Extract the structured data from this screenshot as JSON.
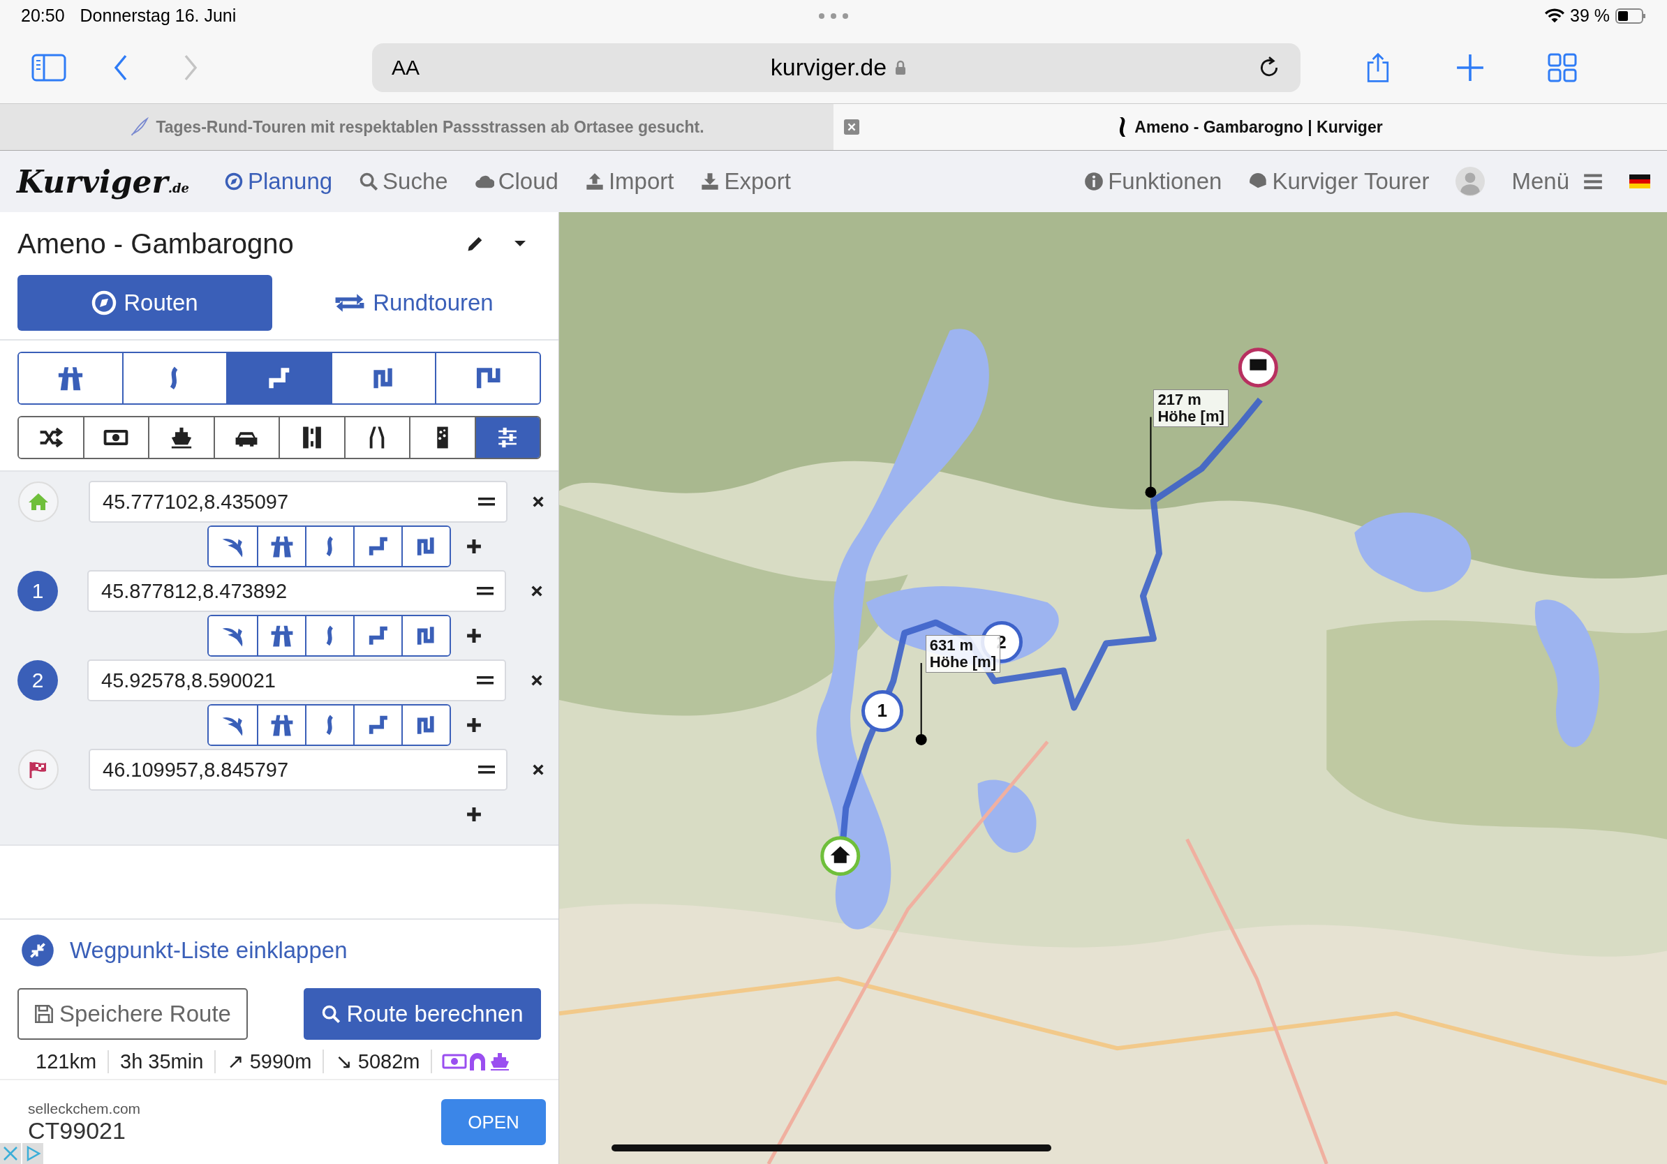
{
  "status_bar": {
    "time": "20:50",
    "date": "Donnerstag 16. Juni",
    "battery": "39 %"
  },
  "browser": {
    "text_size": "AA",
    "url": "kurviger.de"
  },
  "tabs": [
    {
      "title": "Tages-Rund-Touren mit respektablen Passstrassen ab Ortasee gesucht.",
      "selected": false
    },
    {
      "title": "Ameno - Gambarogno | Kurviger",
      "selected": true
    }
  ],
  "nav": {
    "logo": "Kurviger",
    "logo_suffix": ".de",
    "items": [
      {
        "kind": "compass",
        "label": "Planung",
        "selected": true
      },
      {
        "kind": "search",
        "label": "Suche",
        "selected": false
      },
      {
        "kind": "cloud",
        "label": "Cloud",
        "selected": false
      },
      {
        "kind": "upload",
        "label": "Import",
        "selected": false
      },
      {
        "kind": "download",
        "label": "Export",
        "selected": false
      }
    ],
    "right_items": [
      {
        "kind": "info",
        "label": "Funktionen"
      },
      {
        "kind": "helmet",
        "label": "Kurviger Tourer"
      },
      {
        "kind": "avatar"
      },
      {
        "kind": "menu",
        "label": "Menü"
      },
      {
        "kind": "flag"
      }
    ]
  },
  "route_title": "Ameno - Gambarogno",
  "mode_tabs": [
    {
      "kind": "route",
      "label": "Routen",
      "selected": true
    },
    {
      "kind": "round",
      "label": "Rundtouren",
      "selected": false
    }
  ],
  "road_types": [
    {
      "kind": "highway",
      "selected": false
    },
    {
      "kind": "curvy1",
      "selected": false
    },
    {
      "kind": "curvy2",
      "selected": true
    },
    {
      "kind": "curvy3",
      "selected": false
    },
    {
      "kind": "curvy4",
      "selected": false
    }
  ],
  "options": [
    {
      "kind": "shuffle",
      "selected": false
    },
    {
      "kind": "money",
      "selected": false
    },
    {
      "kind": "ship",
      "selected": false
    },
    {
      "kind": "car",
      "selected": false
    },
    {
      "kind": "road",
      "selected": false
    },
    {
      "kind": "tunnel",
      "selected": false
    },
    {
      "kind": "gravel",
      "selected": false
    },
    {
      "kind": "sliders",
      "selected": true
    }
  ],
  "waypoints": [
    {
      "kind": "start",
      "value": "45.777102,8.435097"
    },
    {
      "kind": "via",
      "label": "1",
      "value": "45.877812,8.473892"
    },
    {
      "kind": "via",
      "label": "2",
      "value": "45.92578,8.590021"
    },
    {
      "kind": "end",
      "value": "46.109957,8.845797"
    }
  ],
  "collapse_link": "Wegpunkt-Liste einklappen",
  "save_button": "Speichere Route",
  "calc_button": "Route berechnen",
  "stats": [
    "121km",
    "3h 35min",
    "↗ 5990m",
    "↘ 5082m"
  ],
  "ad": {
    "domain": "selleckchem.com",
    "title": "CT99021",
    "button": "OPEN"
  },
  "map": {
    "kind": "picture",
    "elevation_popups": [
      {
        "value": "631 m",
        "label": "Höhe [m]"
      },
      {
        "value": "217 m",
        "label": "Höhe [m]"
      }
    ],
    "markers": [
      {
        "kind": "start"
      },
      {
        "kind": "via",
        "label": "1"
      },
      {
        "kind": "via",
        "label": "2"
      },
      {
        "kind": "end"
      }
    ]
  }
}
